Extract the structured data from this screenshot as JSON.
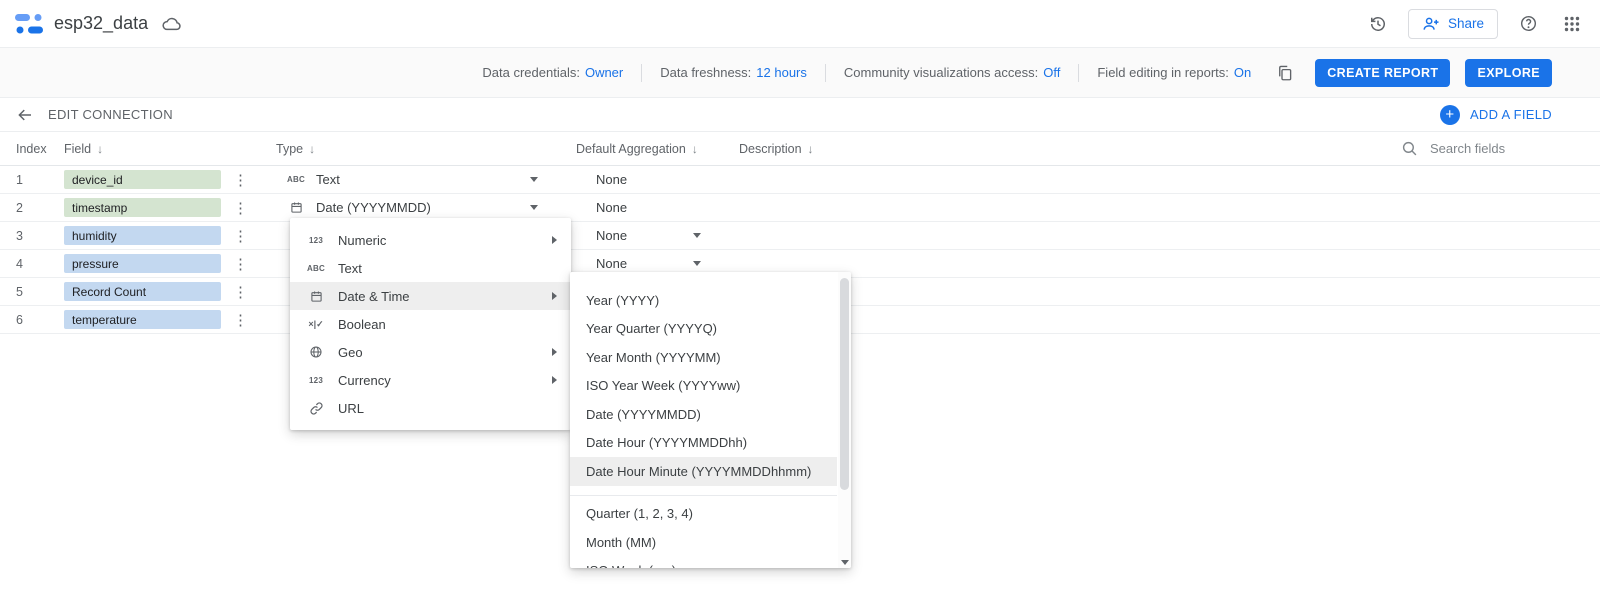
{
  "header": {
    "title": "esp32_data",
    "share_label": "Share"
  },
  "statusbar": {
    "items": [
      {
        "label": "Data credentials:",
        "value": "Owner"
      },
      {
        "label": "Data freshness:",
        "value": "12 hours"
      },
      {
        "label": "Community visualizations access:",
        "value": "Off"
      },
      {
        "label": "Field editing in reports:",
        "value": "On"
      }
    ],
    "create_report_label": "CREATE REPORT",
    "explore_label": "EXPLORE"
  },
  "connection_bar": {
    "edit_connection_label": "EDIT CONNECTION",
    "add_field_label": "ADD A FIELD"
  },
  "table": {
    "headers": {
      "index": "Index",
      "field": "Field",
      "type": "Type",
      "aggregation": "Default Aggregation",
      "description": "Description"
    },
    "search_placeholder": "Search fields",
    "rows": [
      {
        "index": "1",
        "field": "device_id",
        "category": "dimension",
        "type": "Text",
        "type_icon": "text",
        "aggregation": "None",
        "aggregation_editable": false
      },
      {
        "index": "2",
        "field": "timestamp",
        "category": "dimension",
        "type": "Date (YYYYMMDD)",
        "type_icon": "date",
        "aggregation": "None",
        "aggregation_editable": false
      },
      {
        "index": "3",
        "field": "humidity",
        "category": "metric",
        "type": null,
        "aggregation": "None",
        "aggregation_editable": true
      },
      {
        "index": "4",
        "field": "pressure",
        "category": "metric",
        "type": null,
        "aggregation": "None",
        "aggregation_editable": true
      },
      {
        "index": "5",
        "field": "Record Count",
        "category": "metric",
        "type": null,
        "aggregation": null
      },
      {
        "index": "6",
        "field": "temperature",
        "category": "metric",
        "type": null,
        "aggregation": null
      }
    ]
  },
  "type_menu": {
    "items": [
      {
        "label": "Numeric",
        "icon": "numeric",
        "has_submenu": true,
        "highlighted": false
      },
      {
        "label": "Text",
        "icon": "text",
        "has_submenu": false,
        "highlighted": false
      },
      {
        "label": "Date & Time",
        "icon": "date",
        "has_submenu": true,
        "highlighted": true
      },
      {
        "label": "Boolean",
        "icon": "boolean",
        "has_submenu": false,
        "highlighted": false
      },
      {
        "label": "Geo",
        "icon": "geo",
        "has_submenu": true,
        "highlighted": false
      },
      {
        "label": "Currency",
        "icon": "currency",
        "has_submenu": true,
        "highlighted": false
      },
      {
        "label": "URL",
        "icon": "url",
        "has_submenu": false,
        "highlighted": false
      }
    ]
  },
  "date_submenu": {
    "items": [
      {
        "label": "Year (YYYY)",
        "highlighted": false
      },
      {
        "label": "Year Quarter (YYYYQ)",
        "highlighted": false
      },
      {
        "label": "Year Month (YYYYMM)",
        "highlighted": false
      },
      {
        "label": "ISO Year Week (YYYYww)",
        "highlighted": false
      },
      {
        "label": "Date (YYYYMMDD)",
        "highlighted": false
      },
      {
        "label": "Date Hour (YYYYMMDDhh)",
        "highlighted": false
      },
      {
        "label": "Date Hour Minute (YYYYMMDDhhmm)",
        "highlighted": true
      },
      {
        "label": "Quarter (1, 2, 3, 4)",
        "highlighted": false,
        "new_group": true
      },
      {
        "label": "Month (MM)",
        "highlighted": false
      },
      {
        "label": "ISO Week (ww)",
        "highlighted": false,
        "partial": true
      }
    ]
  },
  "icons": [
    "looker-studio-logo",
    "cloud-icon",
    "version-history-icon",
    "person-add-icon",
    "help-icon",
    "apps-grid-icon",
    "duplicate-icon",
    "back-arrow-icon",
    "plus-circle-icon",
    "sort-down-icon",
    "search-icon",
    "more-options-icon",
    "dropdown-caret-icon",
    "submenu-arrow-icon",
    "numeric-icon",
    "text-icon",
    "date-icon",
    "boolean-icon",
    "geo-icon",
    "currency-icon",
    "url-icon",
    "scrollbar-thumb",
    "scroll-down-arrow-icon"
  ],
  "colors": {
    "accent_blue": "#1a73e8",
    "dimension_chip": "#d4e4d0",
    "metric_chip": "#c3d8f0",
    "menu_highlight": "#eeeeee"
  }
}
